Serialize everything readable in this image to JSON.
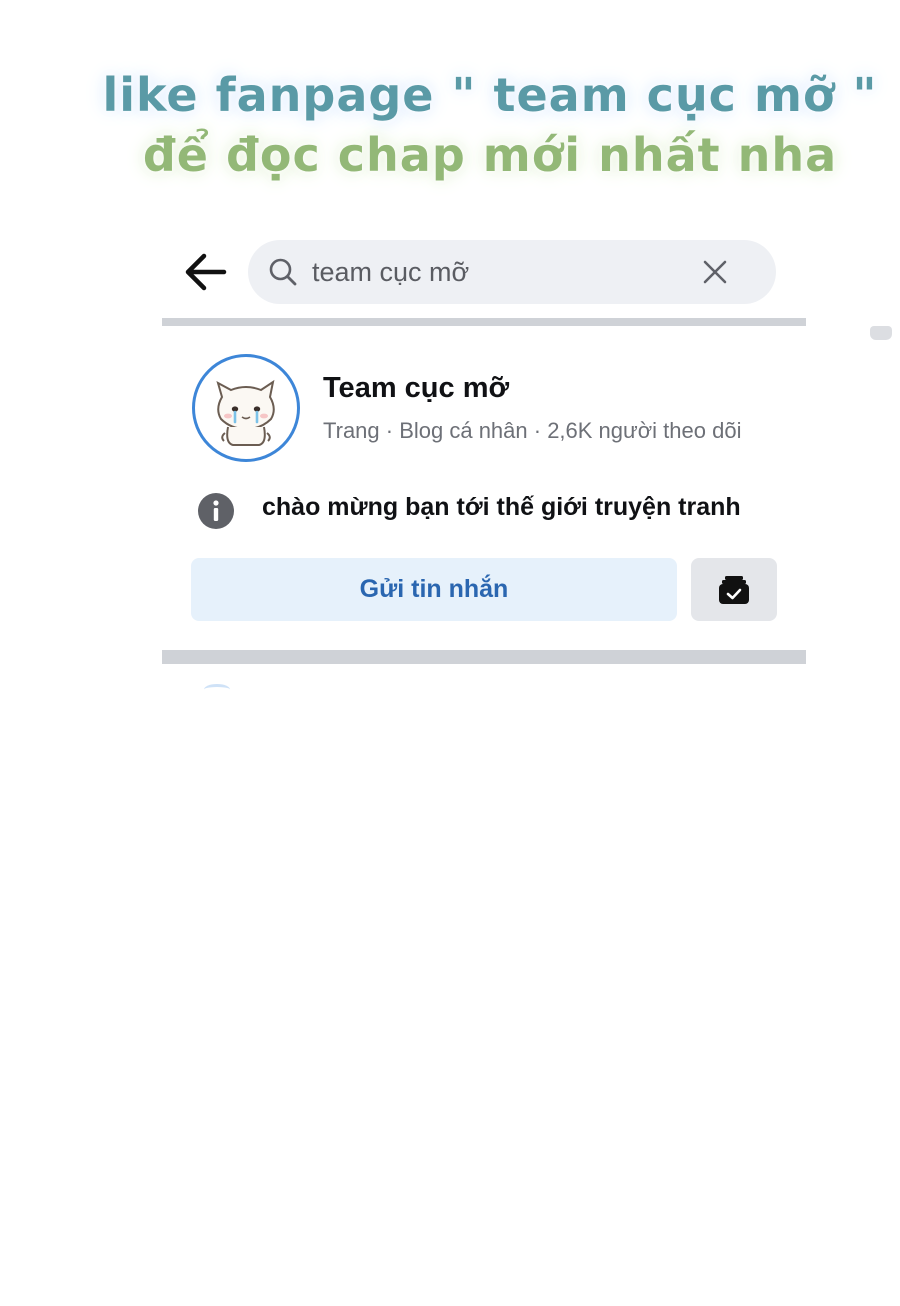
{
  "banner": {
    "line1": "like fanpage \" team cục mỡ \"",
    "line2": "để đọc chap mới nhất nha"
  },
  "header": {
    "back_icon": "arrow-left-icon",
    "search": {
      "icon": "search-icon",
      "value": "team cục mỡ",
      "clear_icon": "close-icon"
    }
  },
  "result": {
    "avatar_icon": "cat-avatar",
    "name": "Team cục mỡ",
    "meta": "Trang · Blog cá nhân · 2,6K người theo dõi",
    "info_icon": "info-icon",
    "bio": "chào mừng bạn tới thế giới truyện tranh",
    "message_button": "Gửi tin nhắn",
    "follow_icon": "followed-check-icon"
  },
  "colors": {
    "banner_line1": "#5a9aa6",
    "banner_line2": "#93b877",
    "accent": "#2a66b0",
    "message_button_bg": "#e6f1fb",
    "avatar_ring": "#3d86d8"
  }
}
